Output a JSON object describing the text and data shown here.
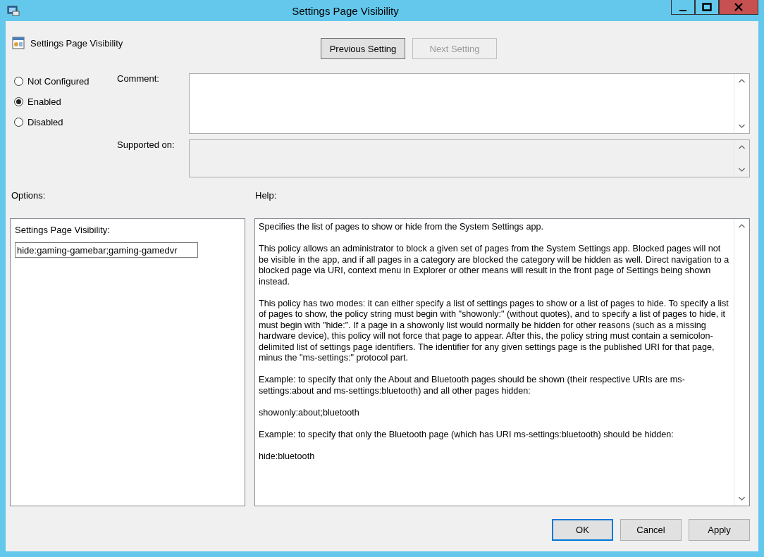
{
  "window": {
    "title": "Settings Page Visibility"
  },
  "header": {
    "policy_name": "Settings Page Visibility",
    "buttons": [
      {
        "label": "Previous Setting",
        "disabled": false
      },
      {
        "label": "Next Setting",
        "disabled": true
      }
    ]
  },
  "state_options": [
    {
      "label": "Not Configured",
      "selected": false
    },
    {
      "label": "Enabled",
      "selected": true
    },
    {
      "label": "Disabled",
      "selected": false
    }
  ],
  "comment": {
    "label": "Comment:"
  },
  "supported_on": {
    "label": "Supported on:"
  },
  "options": {
    "label": "Options:",
    "field_label": "Settings Page Visibility:",
    "value": "hide:gaming-gamebar;gaming-gamedvr"
  },
  "help": {
    "label": "Help:",
    "paragraphs": [
      "Specifies the list of pages to show or hide from the System Settings app.",
      "This policy allows an administrator to block a given set of pages from the System Settings app. Blocked pages will not be visible in the app, and if all pages in a category are blocked the category will be hidden as well. Direct navigation to a blocked page via URI, context menu in Explorer or other means will result in the front page of Settings being shown instead.",
      "This policy has two modes: it can either specify a list of settings pages to show or a list of pages to hide. To specify a list of pages to show, the policy string must begin with \"showonly:\" (without quotes), and to specify a list of pages to hide, it must begin with \"hide:\". If a page in a showonly list would normally be hidden for other reasons (such as a missing hardware device), this policy will not force that page to appear. After this, the policy string must contain a semicolon-delimited list of settings page identifiers. The identifier for any given settings page is the published URI for that page, minus the \"ms-settings:\" protocol part.",
      "Example: to specify that only the About and Bluetooth pages should be shown (their respective URIs are ms-settings:about and ms-settings:bluetooth) and all other pages hidden:",
      "showonly:about;bluetooth",
      "Example: to specify that only the Bluetooth page (which has URI ms-settings:bluetooth) should be hidden:",
      "hide:bluetooth"
    ]
  },
  "footer_buttons": [
    {
      "label": "OK",
      "default": true
    },
    {
      "label": "Cancel",
      "default": false
    },
    {
      "label": "Apply",
      "default": false
    }
  ]
}
